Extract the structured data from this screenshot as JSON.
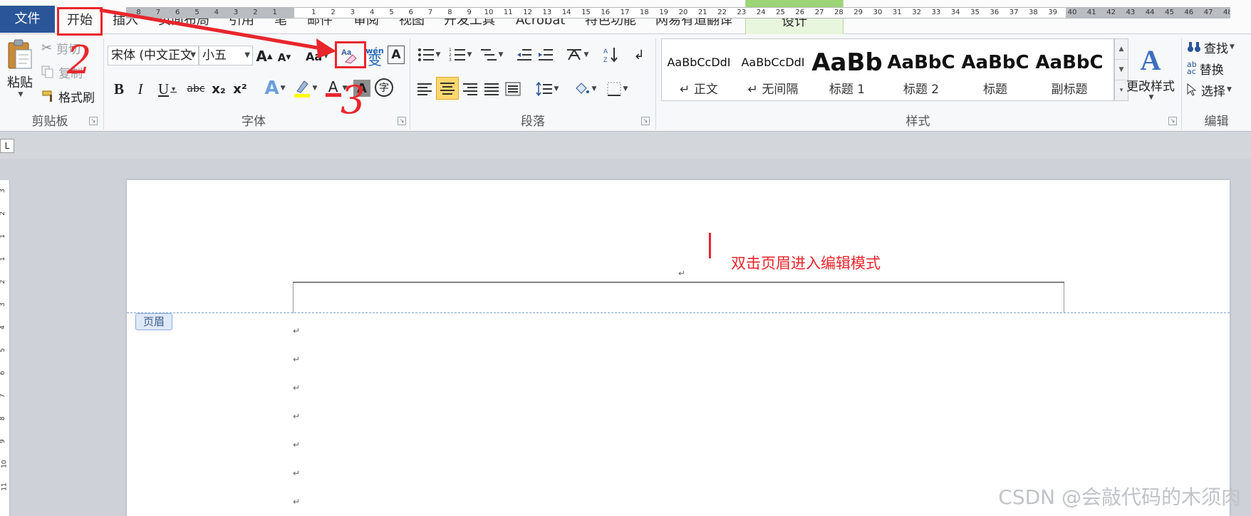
{
  "tabs": {
    "file": "文件",
    "home": "开始",
    "insert": "插入",
    "layout": "页面布局",
    "references": "引用",
    "pen": "笔",
    "mailings": "邮件",
    "review": "审阅",
    "view": "视图",
    "developer": "开发工具",
    "acrobat": "Acrobat",
    "special": "特色功能",
    "youdao": "网易有道翻译",
    "design": "设计"
  },
  "clipboard": {
    "paste": "粘贴",
    "cut": "剪切",
    "copy": "复制",
    "format_painter": "格式刷",
    "label": "剪贴板"
  },
  "font": {
    "name": "宋体 (中文正文",
    "size": "小五",
    "label": "字体",
    "bold": "B",
    "italic": "I",
    "underline": "U",
    "strikethrough": "abc",
    "subscript": "x₂",
    "superscript": "x²",
    "grow": "A",
    "shrink": "A",
    "change_case": "Aa",
    "font_color": "A",
    "char_shading": "A",
    "enclose": "字",
    "phonetic": "wén",
    "phonetic_char": "变",
    "char_border": "A"
  },
  "paragraph": {
    "label": "段落"
  },
  "styles": {
    "label": "样式",
    "items": [
      {
        "sample": "AaBbCcDdI",
        "name": "↵ 正文"
      },
      {
        "sample": "AaBbCcDdI",
        "name": "↵ 无间隔"
      },
      {
        "sample": "AaBb",
        "name": "标题 1"
      },
      {
        "sample": "AaBbC",
        "name": "标题 2"
      },
      {
        "sample": "AaBbC",
        "name": "标题"
      },
      {
        "sample": "AaBbC",
        "name": "副标题"
      }
    ],
    "change_styles": "更改样式"
  },
  "editing": {
    "label": "编辑",
    "find": "查找",
    "replace": "替换",
    "select": "选择"
  },
  "ruler": {
    "tab_selector": "L",
    "left_numbers": [
      "8",
      "7",
      "6",
      "5",
      "4",
      "3",
      "2",
      "1"
    ],
    "right_numbers": [
      "1",
      "2",
      "3",
      "4",
      "5",
      "6",
      "7",
      "8",
      "9",
      "10",
      "11",
      "12",
      "13",
      "14",
      "15",
      "16",
      "17",
      "18",
      "19",
      "20",
      "21",
      "22",
      "23",
      "24",
      "25",
      "26",
      "27",
      "28",
      "29",
      "30",
      "31",
      "32",
      "33",
      "34",
      "35",
      "36",
      "37",
      "38",
      "39",
      "40",
      "41",
      "42",
      "43",
      "44",
      "45",
      "46",
      "47",
      "48"
    ],
    "vertical_numbers": [
      "3",
      "2",
      "1",
      "1",
      "2",
      "3",
      "4",
      "5",
      "6",
      "7",
      "8",
      "9",
      "10",
      "11"
    ]
  },
  "document": {
    "header_tag": "页眉",
    "annotation": "双击页眉进入编辑模式",
    "paragraph_mark": "↵"
  },
  "annotations": {
    "step2": "2",
    "step3": "3"
  },
  "watermark": "CSDN @会敲代码的木须肉",
  "colors": {
    "file_tab": "#2a5699",
    "annotation_red": "#e8262c",
    "design_tab": "#e8f6dd",
    "highlight": "#ffff00",
    "font_color": "#e8262c"
  }
}
